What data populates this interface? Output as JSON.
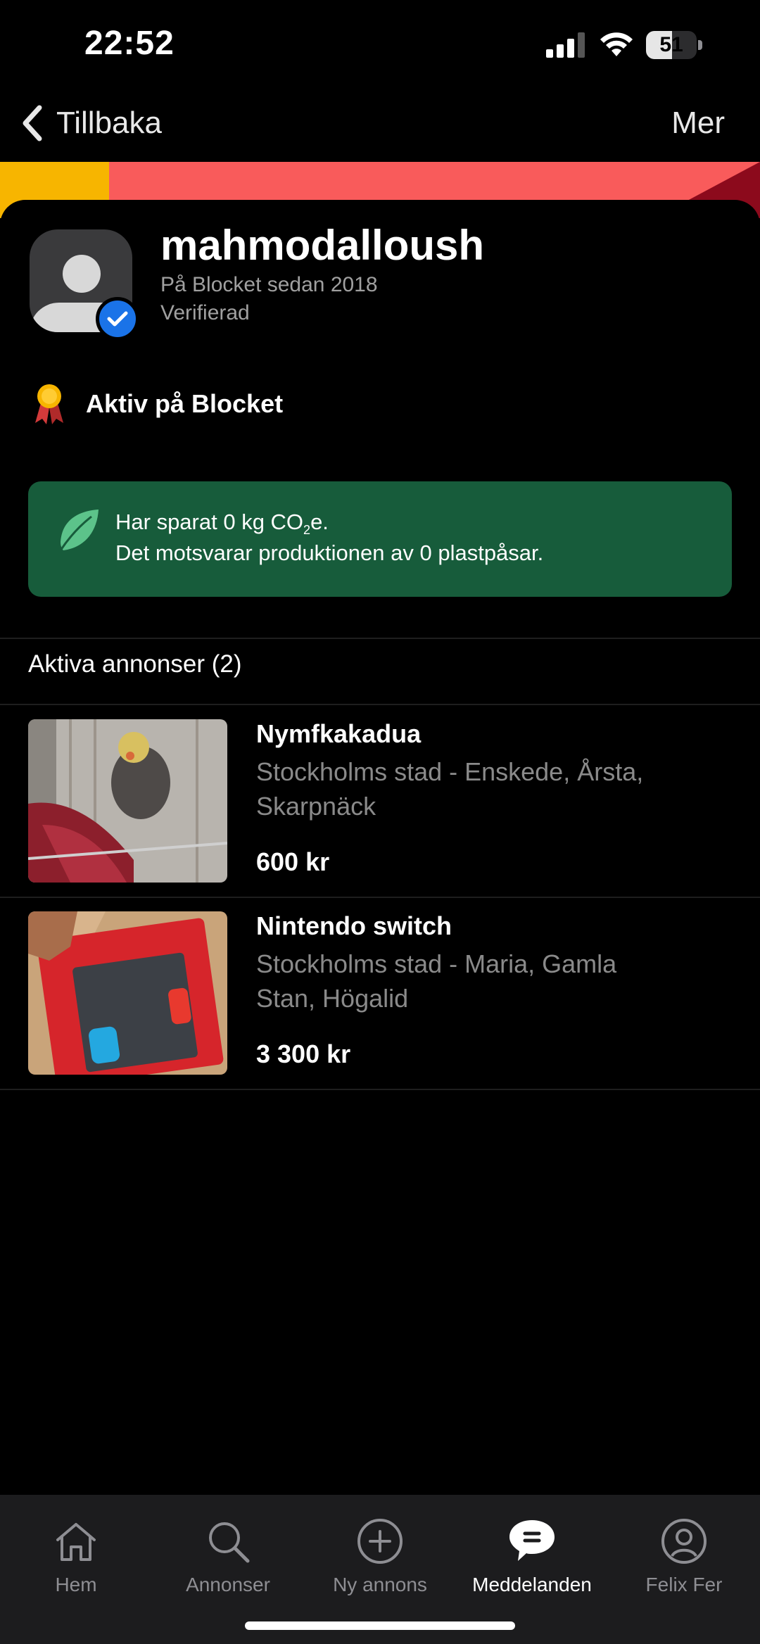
{
  "status_bar": {
    "time": "22:52",
    "battery_percent": 51
  },
  "nav": {
    "back_label": "Tillbaka",
    "more_label": "Mer"
  },
  "profile": {
    "username": "mahmodalloush",
    "member_since": "På Blocket sedan 2018",
    "verified_label": "Verifierad",
    "award_label": "Aktiv på Blocket"
  },
  "co2": {
    "line1_prefix": "Har sparat 0 kg CO",
    "line1_sub": "2",
    "line1_suffix": "e.",
    "line2": "Det motsvarar produktionen av 0 plastpåsar."
  },
  "listings": {
    "section_title": "Aktiva annonser (2)",
    "items": [
      {
        "title": "Nymfkakadua",
        "location": "Stockholms stad - Enskede, Årsta, Skarpnäck",
        "price": "600 kr"
      },
      {
        "title": "Nintendo switch",
        "location": "Stockholms stad - Maria, Gamla Stan, Högalid",
        "price": "3 300 kr"
      }
    ]
  },
  "tab_bar": {
    "items": [
      {
        "label": "Hem",
        "icon": "home-icon"
      },
      {
        "label": "Annonser",
        "icon": "search-icon"
      },
      {
        "label": "Ny annons",
        "icon": "plus-circle-icon"
      },
      {
        "label": "Meddelanden",
        "icon": "chat-bubble-icon",
        "active": true
      },
      {
        "label": "Felix Fer",
        "icon": "profile-icon"
      }
    ]
  },
  "colors": {
    "background": "#000000",
    "co2_box": "#175c3b",
    "verified_blue": "#1a73e8",
    "banner_red": "#f95b5b",
    "banner_yellow": "#f7b500",
    "banner_dark_red": "#8c0a1c",
    "muted_text": "#8a8a8a"
  }
}
